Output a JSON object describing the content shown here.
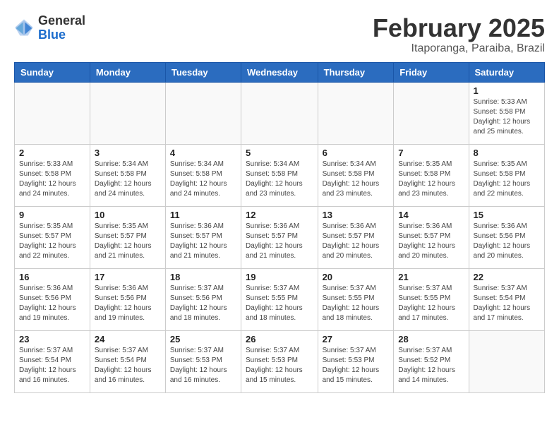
{
  "logo": {
    "general": "General",
    "blue": "Blue"
  },
  "title": {
    "month": "February 2025",
    "location": "Itaporanga, Paraiba, Brazil"
  },
  "days_header": [
    "Sunday",
    "Monday",
    "Tuesday",
    "Wednesday",
    "Thursday",
    "Friday",
    "Saturday"
  ],
  "weeks": [
    [
      {
        "day": "",
        "info": ""
      },
      {
        "day": "",
        "info": ""
      },
      {
        "day": "",
        "info": ""
      },
      {
        "day": "",
        "info": ""
      },
      {
        "day": "",
        "info": ""
      },
      {
        "day": "",
        "info": ""
      },
      {
        "day": "1",
        "info": "Sunrise: 5:33 AM\nSunset: 5:58 PM\nDaylight: 12 hours\nand 25 minutes."
      }
    ],
    [
      {
        "day": "2",
        "info": "Sunrise: 5:33 AM\nSunset: 5:58 PM\nDaylight: 12 hours\nand 24 minutes."
      },
      {
        "day": "3",
        "info": "Sunrise: 5:34 AM\nSunset: 5:58 PM\nDaylight: 12 hours\nand 24 minutes."
      },
      {
        "day": "4",
        "info": "Sunrise: 5:34 AM\nSunset: 5:58 PM\nDaylight: 12 hours\nand 24 minutes."
      },
      {
        "day": "5",
        "info": "Sunrise: 5:34 AM\nSunset: 5:58 PM\nDaylight: 12 hours\nand 23 minutes."
      },
      {
        "day": "6",
        "info": "Sunrise: 5:34 AM\nSunset: 5:58 PM\nDaylight: 12 hours\nand 23 minutes."
      },
      {
        "day": "7",
        "info": "Sunrise: 5:35 AM\nSunset: 5:58 PM\nDaylight: 12 hours\nand 23 minutes."
      },
      {
        "day": "8",
        "info": "Sunrise: 5:35 AM\nSunset: 5:58 PM\nDaylight: 12 hours\nand 22 minutes."
      }
    ],
    [
      {
        "day": "9",
        "info": "Sunrise: 5:35 AM\nSunset: 5:57 PM\nDaylight: 12 hours\nand 22 minutes."
      },
      {
        "day": "10",
        "info": "Sunrise: 5:35 AM\nSunset: 5:57 PM\nDaylight: 12 hours\nand 21 minutes."
      },
      {
        "day": "11",
        "info": "Sunrise: 5:36 AM\nSunset: 5:57 PM\nDaylight: 12 hours\nand 21 minutes."
      },
      {
        "day": "12",
        "info": "Sunrise: 5:36 AM\nSunset: 5:57 PM\nDaylight: 12 hours\nand 21 minutes."
      },
      {
        "day": "13",
        "info": "Sunrise: 5:36 AM\nSunset: 5:57 PM\nDaylight: 12 hours\nand 20 minutes."
      },
      {
        "day": "14",
        "info": "Sunrise: 5:36 AM\nSunset: 5:57 PM\nDaylight: 12 hours\nand 20 minutes."
      },
      {
        "day": "15",
        "info": "Sunrise: 5:36 AM\nSunset: 5:56 PM\nDaylight: 12 hours\nand 20 minutes."
      }
    ],
    [
      {
        "day": "16",
        "info": "Sunrise: 5:36 AM\nSunset: 5:56 PM\nDaylight: 12 hours\nand 19 minutes."
      },
      {
        "day": "17",
        "info": "Sunrise: 5:36 AM\nSunset: 5:56 PM\nDaylight: 12 hours\nand 19 minutes."
      },
      {
        "day": "18",
        "info": "Sunrise: 5:37 AM\nSunset: 5:56 PM\nDaylight: 12 hours\nand 18 minutes."
      },
      {
        "day": "19",
        "info": "Sunrise: 5:37 AM\nSunset: 5:55 PM\nDaylight: 12 hours\nand 18 minutes."
      },
      {
        "day": "20",
        "info": "Sunrise: 5:37 AM\nSunset: 5:55 PM\nDaylight: 12 hours\nand 18 minutes."
      },
      {
        "day": "21",
        "info": "Sunrise: 5:37 AM\nSunset: 5:55 PM\nDaylight: 12 hours\nand 17 minutes."
      },
      {
        "day": "22",
        "info": "Sunrise: 5:37 AM\nSunset: 5:54 PM\nDaylight: 12 hours\nand 17 minutes."
      }
    ],
    [
      {
        "day": "23",
        "info": "Sunrise: 5:37 AM\nSunset: 5:54 PM\nDaylight: 12 hours\nand 16 minutes."
      },
      {
        "day": "24",
        "info": "Sunrise: 5:37 AM\nSunset: 5:54 PM\nDaylight: 12 hours\nand 16 minutes."
      },
      {
        "day": "25",
        "info": "Sunrise: 5:37 AM\nSunset: 5:53 PM\nDaylight: 12 hours\nand 16 minutes."
      },
      {
        "day": "26",
        "info": "Sunrise: 5:37 AM\nSunset: 5:53 PM\nDaylight: 12 hours\nand 15 minutes."
      },
      {
        "day": "27",
        "info": "Sunrise: 5:37 AM\nSunset: 5:53 PM\nDaylight: 12 hours\nand 15 minutes."
      },
      {
        "day": "28",
        "info": "Sunrise: 5:37 AM\nSunset: 5:52 PM\nDaylight: 12 hours\nand 14 minutes."
      },
      {
        "day": "",
        "info": ""
      }
    ]
  ]
}
